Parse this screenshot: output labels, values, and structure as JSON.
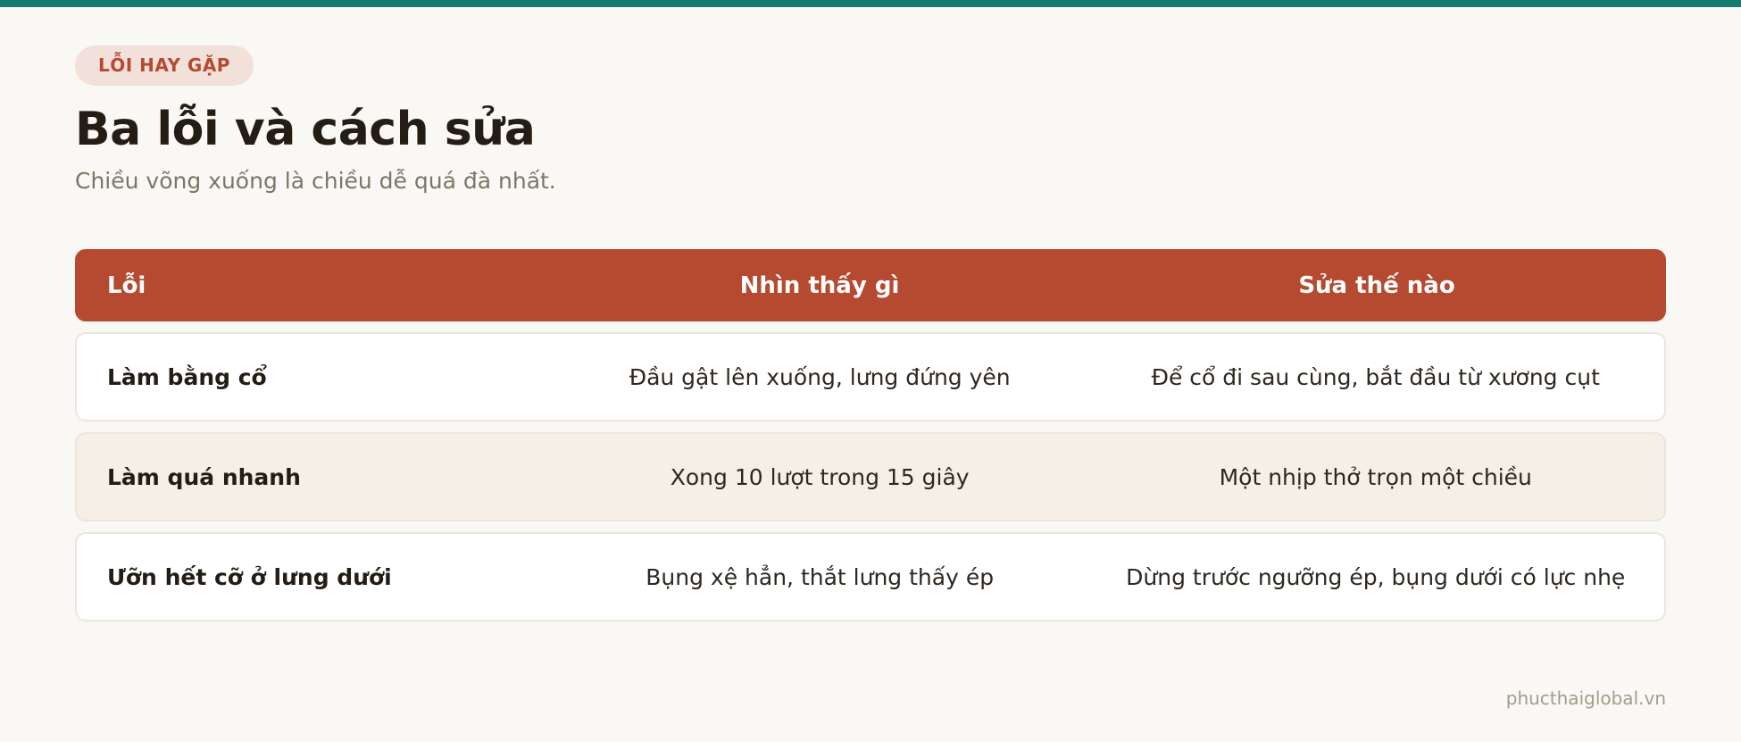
{
  "badge": "LỖI HAY GẶP",
  "title": "Ba lỗi và cách sửa",
  "subtitle": "Chiều võng xuống là chiều dễ quá đà nhất.",
  "table": {
    "headers": [
      "Lỗi",
      "Nhìn thấy gì",
      "Sửa thế nào"
    ],
    "rows": [
      [
        "Làm bằng cổ",
        "Đầu gật lên xuống, lưng đứng yên",
        "Để cổ đi sau cùng, bắt đầu từ xương cụt"
      ],
      [
        "Làm quá nhanh",
        "Xong 10 lượt trong 15 giây",
        "Một nhịp thở trọn một chiều"
      ],
      [
        "Ưỡn hết cỡ ở lưng dưới",
        "Bụng xệ hẳn, thắt lưng thấy ép",
        "Dừng trước ngưỡng ép, bụng dưới có lực nhẹ"
      ]
    ]
  },
  "footer": "phucthaiglobal.vn",
  "colors": {
    "accent": "#b54a31",
    "top_bar": "#177a70",
    "background": "#faf8f4",
    "alt_row": "#f5efe8"
  }
}
